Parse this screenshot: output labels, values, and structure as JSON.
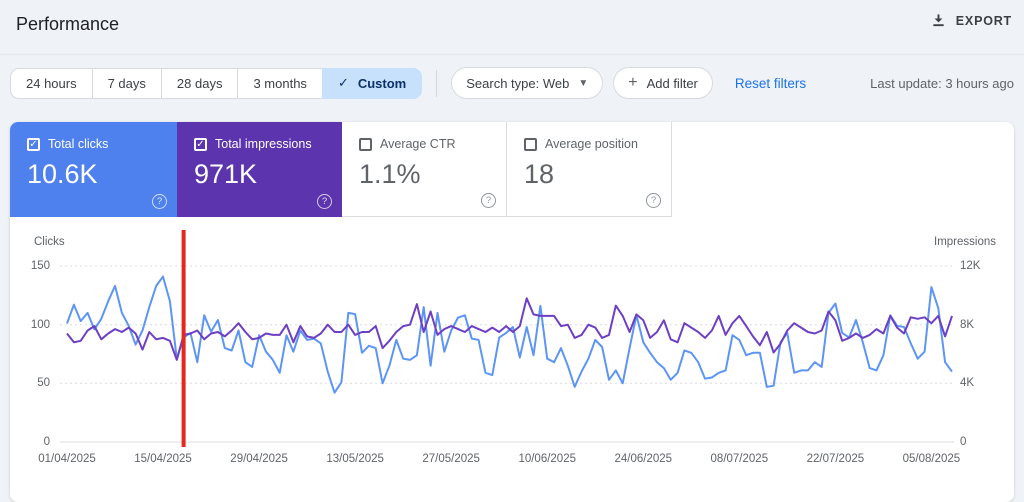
{
  "header": {
    "title": "Performance",
    "export_label": "EXPORT"
  },
  "filters": {
    "date_ranges": [
      {
        "label": "24 hours",
        "selected": false
      },
      {
        "label": "7 days",
        "selected": false
      },
      {
        "label": "28 days",
        "selected": false
      },
      {
        "label": "3 months",
        "selected": false
      },
      {
        "label": "Custom",
        "selected": true
      }
    ],
    "search_type_label": "Search type: Web",
    "add_filter_label": "Add filter",
    "reset_filters_label": "Reset filters",
    "last_update": "Last update: 3 hours ago"
  },
  "metrics": [
    {
      "label": "Total clicks",
      "value": "10.6K",
      "checked": true,
      "color": "#4e80ee"
    },
    {
      "label": "Total impressions",
      "value": "971K",
      "checked": true,
      "color": "#5c34ad"
    },
    {
      "label": "Average CTR",
      "value": "1.1%",
      "checked": false,
      "color": "#ffffff"
    },
    {
      "label": "Average position",
      "value": "18",
      "checked": false,
      "color": "#ffffff"
    }
  ],
  "chart_data": {
    "type": "line",
    "grid": "horizontal-dotted",
    "left_axis": {
      "label": "Clicks",
      "range": [
        0,
        150
      ],
      "tick_values": [
        150,
        100,
        50,
        0
      ],
      "tick_labels": [
        "150",
        "100",
        "50",
        "0"
      ]
    },
    "right_axis": {
      "label": "Impressions",
      "range": [
        0,
        12000
      ],
      "tick_values": [
        12000,
        8000,
        4000,
        0
      ],
      "tick_labels": [
        "12K",
        "8K",
        "4K",
        "0"
      ]
    },
    "x_tick_labels": [
      "01/04/2025",
      "15/04/2025",
      "29/04/2025",
      "13/05/2025",
      "27/05/2025",
      "10/06/2025",
      "24/06/2025",
      "08/07/2025",
      "22/07/2025",
      "05/08/2025"
    ],
    "x_tick_days": [
      0,
      14,
      28,
      42,
      56,
      70,
      84,
      98,
      112,
      126
    ],
    "marker": {
      "day": 17,
      "date": "18/04/2025",
      "color": "#e5281d"
    },
    "series": [
      {
        "name": "Total clicks",
        "axis": "left",
        "color": "#5c95f5",
        "values": [
          101,
          117,
          103,
          110,
          96,
          105,
          120,
          133,
          110,
          99,
          83,
          95,
          115,
          133,
          141,
          120,
          71,
          89,
          93,
          68,
          108,
          94,
          104,
          80,
          78,
          95,
          68,
          64,
          91,
          77,
          70,
          59,
          91,
          77,
          95,
          87,
          88,
          84,
          60,
          42,
          51,
          110,
          109,
          76,
          82,
          80,
          50,
          65,
          87,
          71,
          70,
          74,
          115,
          65,
          110,
          77,
          95,
          106,
          108,
          88,
          87,
          59,
          57,
          89,
          93,
          98,
          72,
          98,
          74,
          116,
          71,
          68,
          80,
          65,
          47,
          60,
          71,
          87,
          81,
          53,
          61,
          50,
          80,
          108,
          85,
          76,
          68,
          63,
          53,
          59,
          78,
          76,
          68,
          54,
          55,
          59,
          61,
          91,
          87,
          74,
          76,
          76,
          47,
          48,
          85,
          93,
          59,
          61,
          61,
          68,
          64,
          110,
          118,
          93,
          89,
          104,
          85,
          63,
          61,
          74,
          108,
          99,
          98,
          84,
          71,
          77,
          132,
          114,
          68,
          60
        ]
      },
      {
        "name": "Total impressions",
        "axis": "right",
        "color": "#6d3fc4",
        "values": [
          7400,
          6800,
          6900,
          7600,
          7900,
          7000,
          7400,
          7700,
          7500,
          7800,
          7400,
          6300,
          7500,
          7000,
          7100,
          6900,
          5600,
          7300,
          7400,
          7600,
          7000,
          7400,
          7500,
          7200,
          7600,
          8100,
          7500,
          7000,
          7100,
          7400,
          7300,
          7300,
          8000,
          6800,
          7900,
          7200,
          7100,
          7400,
          8000,
          7500,
          7500,
          8000,
          7300,
          7500,
          7500,
          7900,
          6400,
          6900,
          7500,
          7900,
          8000,
          9400,
          7500,
          8900,
          7300,
          7700,
          7900,
          7700,
          7500,
          7900,
          7700,
          7500,
          7800,
          7500,
          7900,
          7500,
          7900,
          9800,
          8700,
          8600,
          8600,
          8600,
          7900,
          8000,
          7100,
          7300,
          8000,
          7800,
          7100,
          7300,
          9300,
          8600,
          7500,
          8700,
          8300,
          7100,
          7500,
          8300,
          7000,
          6800,
          8100,
          7800,
          7500,
          7100,
          7600,
          8600,
          7300,
          8100,
          8600,
          7900,
          7200,
          6600,
          7500,
          6100,
          6700,
          7600,
          8100,
          7800,
          7500,
          7400,
          7600,
          8900,
          8300,
          6900,
          7100,
          7400,
          7100,
          7300,
          7700,
          7400,
          8600,
          7800,
          7400,
          8500,
          8400,
          8500,
          8100,
          8600,
          7200,
          8600
        ]
      }
    ]
  }
}
